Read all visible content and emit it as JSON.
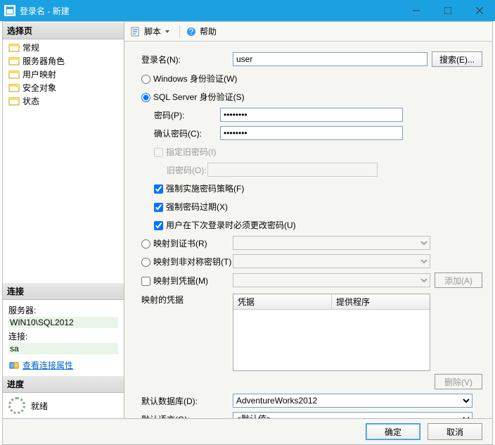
{
  "window": {
    "title": "登录名 - 新建"
  },
  "sidebar": {
    "select_page": "选择页",
    "items": [
      {
        "label": "常规"
      },
      {
        "label": "服务器角色"
      },
      {
        "label": "用户映射"
      },
      {
        "label": "安全对象"
      },
      {
        "label": "状态"
      }
    ],
    "connection": {
      "head": "连接",
      "server_label": "服务器:",
      "server_value": "WIN10\\SQL2012",
      "conn_label": "连接:",
      "conn_value": "sa",
      "view_props": "查看连接属性"
    },
    "progress": {
      "head": "进度",
      "status": "就绪"
    }
  },
  "toolbar": {
    "script": "脚本",
    "help": "帮助"
  },
  "form": {
    "login_name_label": "登录名(N):",
    "login_name_value": "user",
    "search_btn": "搜索(E)...",
    "win_auth": "Windows 身份验证(W)",
    "sql_auth": "SQL Server 身份验证(S)",
    "password_label": "密码(P):",
    "password_value": "••••••••",
    "confirm_label": "确认密码(C):",
    "confirm_value": "••••••••",
    "specify_old": "指定旧密码(I)",
    "old_pw_label": "旧密码(O):",
    "enforce_policy": "强制实施密码策略(F)",
    "enforce_expire": "强制密码过期(X)",
    "must_change": "用户在下次登录时必须更改密码(U)",
    "map_cert": "映射到证书(R)",
    "map_asym": "映射到非对称密钥(T)",
    "map_cred": "映射到凭据(M)",
    "add_btn": "添加(A)",
    "mapped_creds_label": "映射的凭据",
    "grid_col1": "凭据",
    "grid_col2": "提供程序",
    "remove_btn": "删除(V)",
    "default_db_label": "默认数据库(D):",
    "default_db_value": "AdventureWorks2012",
    "default_lang_label": "默认语言(G):",
    "default_lang_value": "<默认值>"
  },
  "buttons": {
    "ok": "确定",
    "cancel": "取消"
  }
}
